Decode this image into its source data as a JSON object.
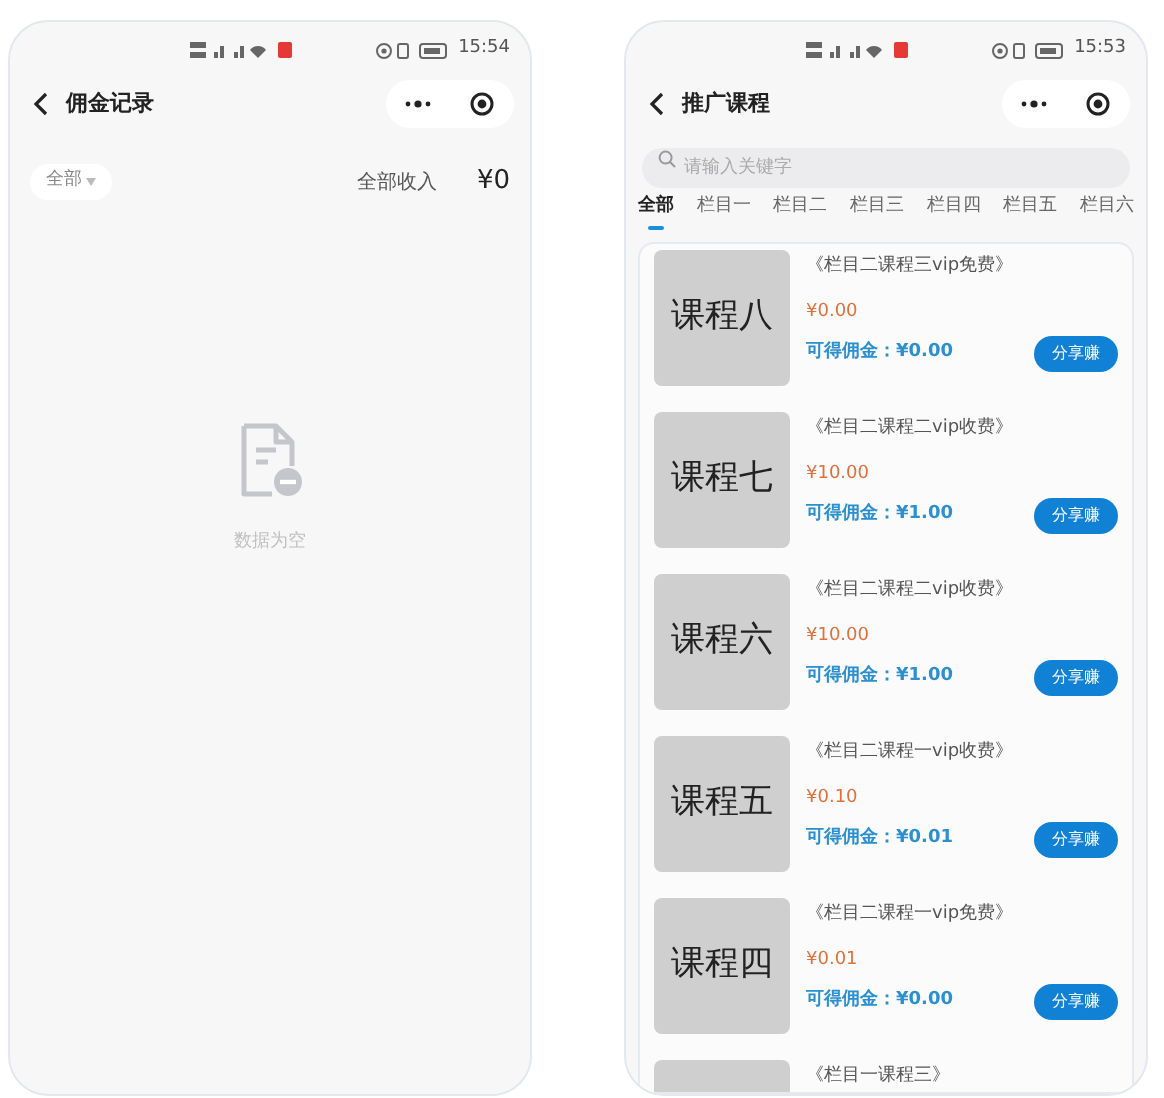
{
  "screens": [
    {
      "kind": "records",
      "status_bar": {
        "time": "15:54"
      },
      "nav": {
        "title": "佣金记录"
      },
      "filter": {
        "label": "全部"
      },
      "summary": {
        "label": "全部收入",
        "amount": "¥0"
      },
      "empty": {
        "text": "数据为空"
      }
    },
    {
      "kind": "courses",
      "status_bar": {
        "time": "15:53"
      },
      "nav": {
        "title": "推广课程"
      },
      "search": {
        "placeholder": "请输入关键字"
      },
      "tabs": [
        {
          "label": "全部",
          "selected": true
        },
        {
          "label": "栏目一",
          "selected": false
        },
        {
          "label": "栏目二",
          "selected": false
        },
        {
          "label": "栏目三",
          "selected": false
        },
        {
          "label": "栏目四",
          "selected": false
        },
        {
          "label": "栏目五",
          "selected": false
        },
        {
          "label": "栏目六",
          "selected": false
        }
      ],
      "courses": [
        {
          "thumbnail_text": "课程八",
          "title": "《栏目二课程三vip免费》",
          "price": "¥0.00",
          "commission": "可得佣金：¥0.00",
          "button": "分享赚"
        },
        {
          "thumbnail_text": "课程七",
          "title": "《栏目二课程二vip收费》",
          "price": "¥10.00",
          "commission": "可得佣金：¥1.00",
          "button": "分享赚"
        },
        {
          "thumbnail_text": "课程六",
          "title": "《栏目二课程二vip收费》",
          "price": "¥10.00",
          "commission": "可得佣金：¥1.00",
          "button": "分享赚"
        },
        {
          "thumbnail_text": "课程五",
          "title": "《栏目二课程一vip收费》",
          "price": "¥0.10",
          "commission": "可得佣金：¥0.01",
          "button": "分享赚"
        },
        {
          "thumbnail_text": "课程四",
          "title": "《栏目二课程一vip免费》",
          "price": "¥0.01",
          "commission": "可得佣金：¥0.00",
          "button": "分享赚"
        },
        {
          "title": "《栏目一课程三》"
        }
      ]
    }
  ]
}
